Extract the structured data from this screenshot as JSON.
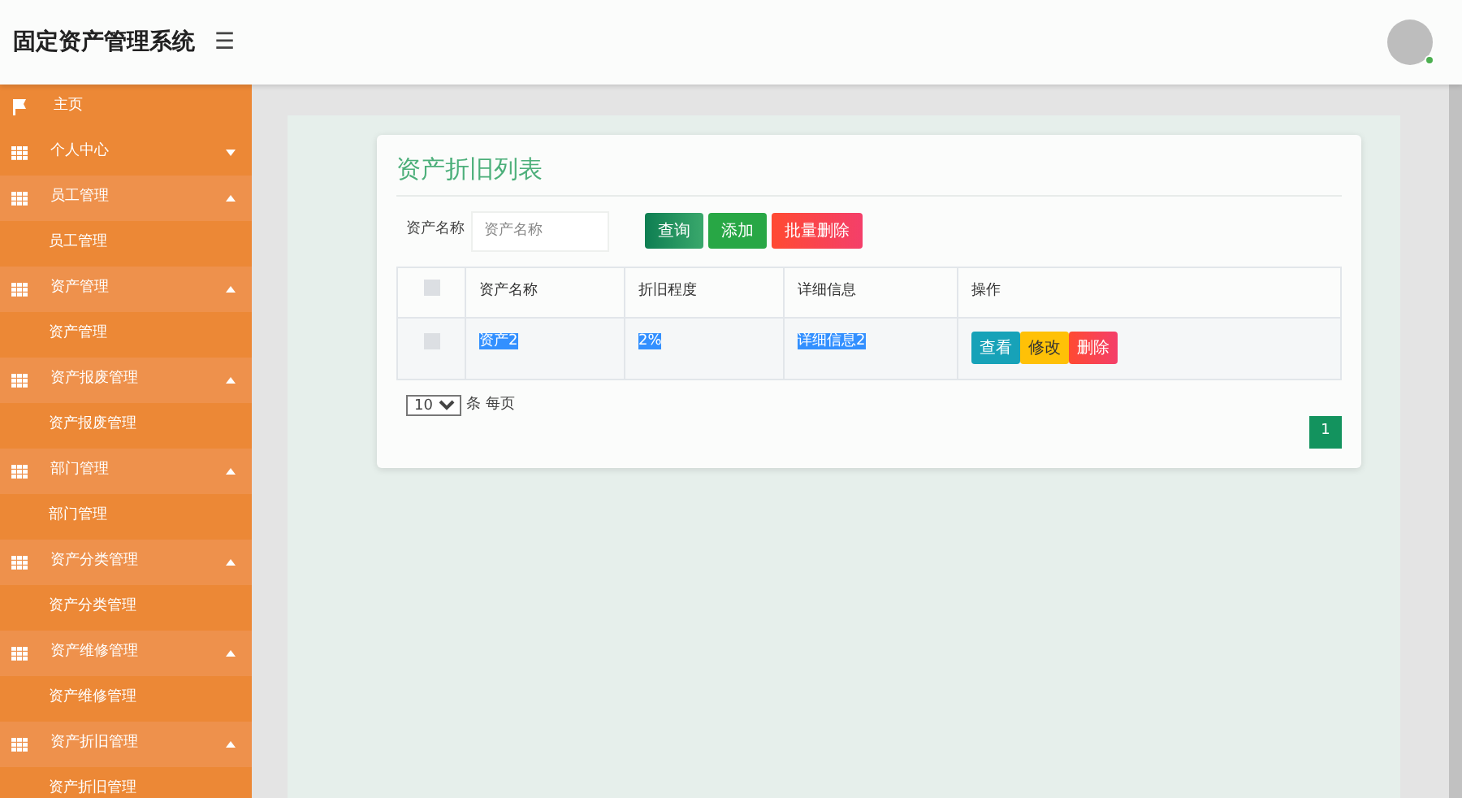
{
  "header": {
    "title": "固定资产管理系统",
    "menu_icon": "☰"
  },
  "sidebar": {
    "items": [
      {
        "label": "主页",
        "kind": "link"
      },
      {
        "label": "个人中心",
        "kind": "group",
        "expanded": false
      },
      {
        "label": "员工管理",
        "kind": "group",
        "expanded": true,
        "children": [
          {
            "label": "员工管理"
          }
        ]
      },
      {
        "label": "资产管理",
        "kind": "group",
        "expanded": true,
        "children": [
          {
            "label": "资产管理"
          }
        ]
      },
      {
        "label": "资产报废管理",
        "kind": "group",
        "expanded": true,
        "children": [
          {
            "label": "资产报废管理"
          }
        ]
      },
      {
        "label": "部门管理",
        "kind": "group",
        "expanded": true,
        "children": [
          {
            "label": "部门管理"
          }
        ]
      },
      {
        "label": "资产分类管理",
        "kind": "group",
        "expanded": true,
        "children": [
          {
            "label": "资产分类管理"
          }
        ]
      },
      {
        "label": "资产维修管理",
        "kind": "group",
        "expanded": true,
        "children": [
          {
            "label": "资产维修管理"
          }
        ]
      },
      {
        "label": "资产折旧管理",
        "kind": "group",
        "expanded": true,
        "children": [
          {
            "label": "资产折旧管理"
          }
        ]
      }
    ]
  },
  "card": {
    "title": "资产折旧列表",
    "search": {
      "label": "资产名称",
      "placeholder": "资产名称"
    },
    "buttons": [
      {
        "label": "查询",
        "kind": "search"
      },
      {
        "label": "添加",
        "kind": "add"
      },
      {
        "label": "批量删除",
        "kind": "delete"
      }
    ],
    "table": {
      "select_all_checked": false,
      "columns": [
        "资产名称",
        "折旧程度",
        "详细信息",
        "操作"
      ],
      "rows": [
        {
          "checked": false,
          "cells": [
            {
              "text": "资产2",
              "highlighted": true
            },
            {
              "text": "2%",
              "highlighted": true
            },
            {
              "text": "详细信息2",
              "highlighted": true
            }
          ],
          "actions": [
            {
              "label": "查看",
              "kind": "view"
            },
            {
              "label": "修改",
              "kind": "edit"
            },
            {
              "label": "删除",
              "kind": "delete"
            }
          ]
        }
      ]
    },
    "page_size": {
      "value": "10",
      "suffix": "条 每页"
    },
    "pages": [
      {
        "label": "1",
        "selected": true
      }
    ]
  }
}
